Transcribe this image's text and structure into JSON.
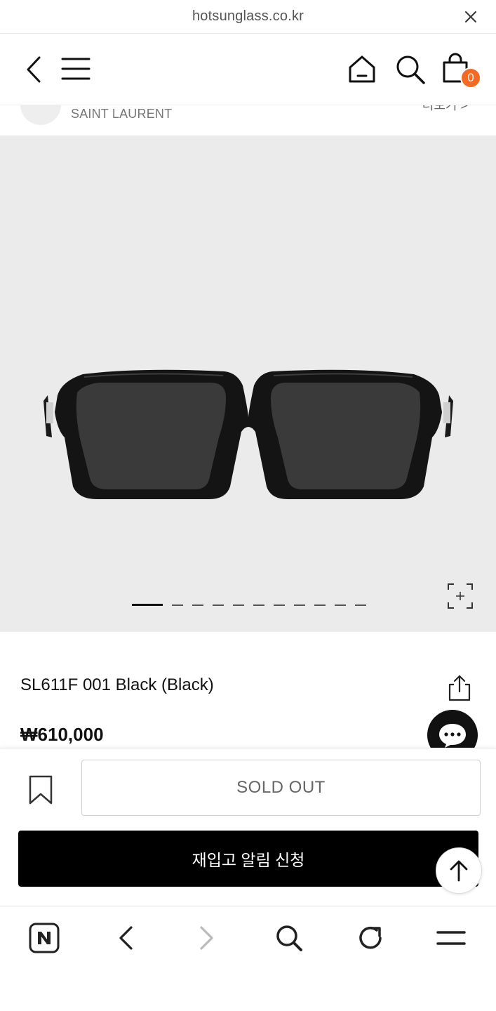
{
  "browser": {
    "url": "hotsunglass.co.kr"
  },
  "header": {
    "cart_count": "0"
  },
  "brand": {
    "name": "SAINT LAURENT",
    "more_label": "더보기 >"
  },
  "gallery": {
    "total_slides": 12,
    "active_slide": 1
  },
  "product": {
    "name": "SL611F 001 Black (Black)",
    "price": "₩610,000"
  },
  "actions": {
    "sold_out_label": "SOLD OUT",
    "restock_label": "재입고 알림 신청"
  },
  "colors": {
    "accent_badge": "#f26a24",
    "button_dark": "#000000",
    "gallery_bg": "#ebebeb"
  },
  "icons": {
    "back": "back-chevron-icon",
    "menu": "hamburger-menu-icon",
    "home": "home-icon",
    "search": "search-icon",
    "cart": "shopping-bag-icon",
    "zoom": "zoom-expand-icon",
    "share": "share-icon",
    "chat": "chat-bubble-icon",
    "bookmark": "bookmark-icon",
    "scroll_top": "arrow-up-icon",
    "naver": "naver-n-icon",
    "nav_back": "nav-back-icon",
    "nav_forward": "nav-forward-icon",
    "nav_search": "nav-search-icon",
    "reload": "reload-icon",
    "nav_menu": "nav-menu-icon"
  }
}
